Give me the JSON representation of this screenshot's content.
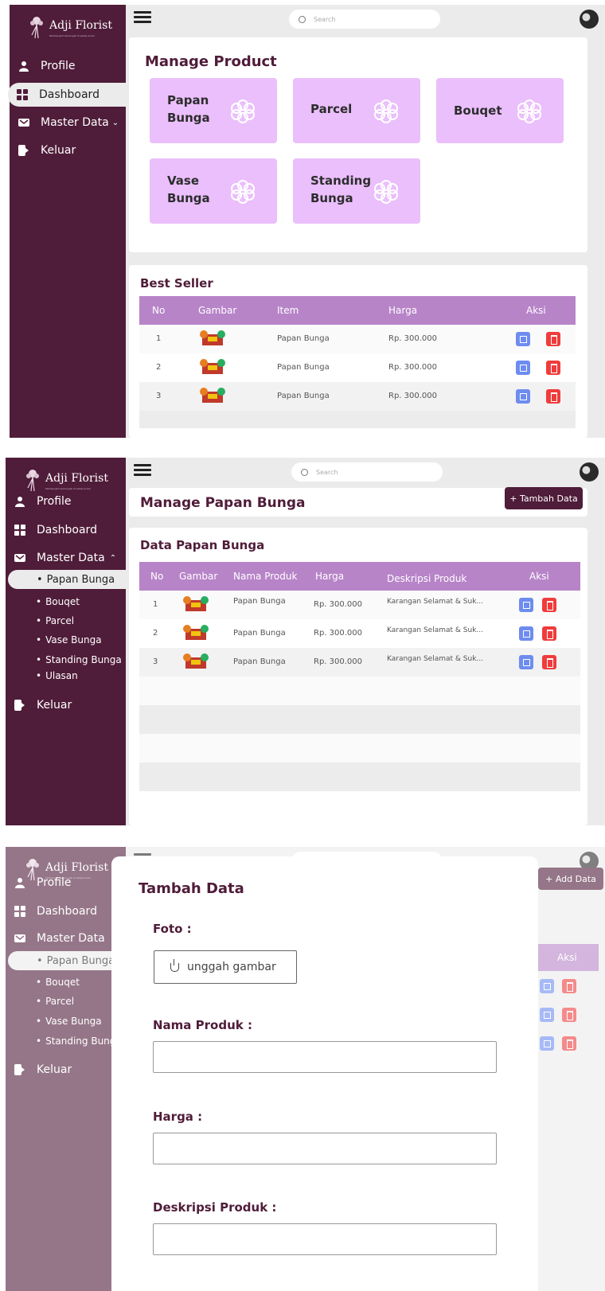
{
  "brand": {
    "name": "Adji Florist",
    "tagline": "Pembangkit semangat di setiap acara"
  },
  "colors": {
    "sidebar": "#4f1c39",
    "accent": "#b784c8",
    "tile": "#eabffb",
    "edit": "#6d8cf0",
    "delete": "#ef3c3c"
  },
  "search": {
    "placeholder": "Search"
  },
  "screen1": {
    "nav": {
      "profile": "Profile",
      "dashboard": "Dashboard",
      "master": "Master Data",
      "logout": "Keluar"
    },
    "title": "Manage Product",
    "tiles": [
      {
        "label": "Papan\nBunga"
      },
      {
        "label": "Parcel"
      },
      {
        "label": "Bouqet"
      },
      {
        "label": "Vase\nBunga"
      },
      {
        "label": "Standing\nBunga"
      }
    ],
    "best_seller": {
      "title": "Best Seller",
      "headers": [
        "No",
        "Gambar",
        "Item",
        "Harga",
        "Aksi"
      ],
      "rows": [
        {
          "no": "1",
          "item": "Papan Bunga",
          "harga": "Rp. 300.000"
        },
        {
          "no": "2",
          "item": "Papan Bunga",
          "harga": "Rp. 300.000"
        },
        {
          "no": "3",
          "item": "Papan Bunga",
          "harga": "Rp. 300.000"
        }
      ]
    }
  },
  "screen2": {
    "nav": {
      "profile": "Profile",
      "dashboard": "Dashboard",
      "master": "Master Data",
      "logout": "Keluar"
    },
    "sub_items": [
      "Papan Bunga",
      "Bouqet",
      "Parcel",
      "Vase Bunga",
      "Standing Bunga",
      "Ulasan"
    ],
    "title": "Manage Papan Bunga",
    "add_button": "+ Tambah Data",
    "table_title": "Data Papan Bunga",
    "headers": [
      "No",
      "Gambar",
      "Nama Produk",
      "Harga",
      "Deskripsi Produk",
      "Aksi"
    ],
    "rows": [
      {
        "no": "1",
        "nama": "Papan Bunga",
        "harga": "Rp. 300.000",
        "desk": "Karangan Selamat & Suk..."
      },
      {
        "no": "2",
        "nama": "Papan Bunga",
        "harga": "Rp. 300.000",
        "desk": "Karangan Selamat & Suk..."
      },
      {
        "no": "3",
        "nama": "Papan Bunga",
        "harga": "Rp. 300.000",
        "desk": "Karangan Selamat & Suk..."
      }
    ]
  },
  "screen3": {
    "nav": {
      "profile": "Profile",
      "dashboard": "Dashboard",
      "master": "Master Data",
      "logout": "Keluar"
    },
    "sub_items": [
      "Papan Bunga",
      "Bouqet",
      "Parcel",
      "Vase Bunga",
      "Standing Bunga"
    ],
    "add_button": "+ Add Data",
    "aksi_header": "Aksi",
    "modal": {
      "title": "Tambah Data",
      "foto_label": "Foto :",
      "upload_label": "unggah gambar",
      "nama_label": "Nama Produk :",
      "harga_label": "Harga :",
      "desk_label": "Deskripsi Produk :"
    }
  }
}
